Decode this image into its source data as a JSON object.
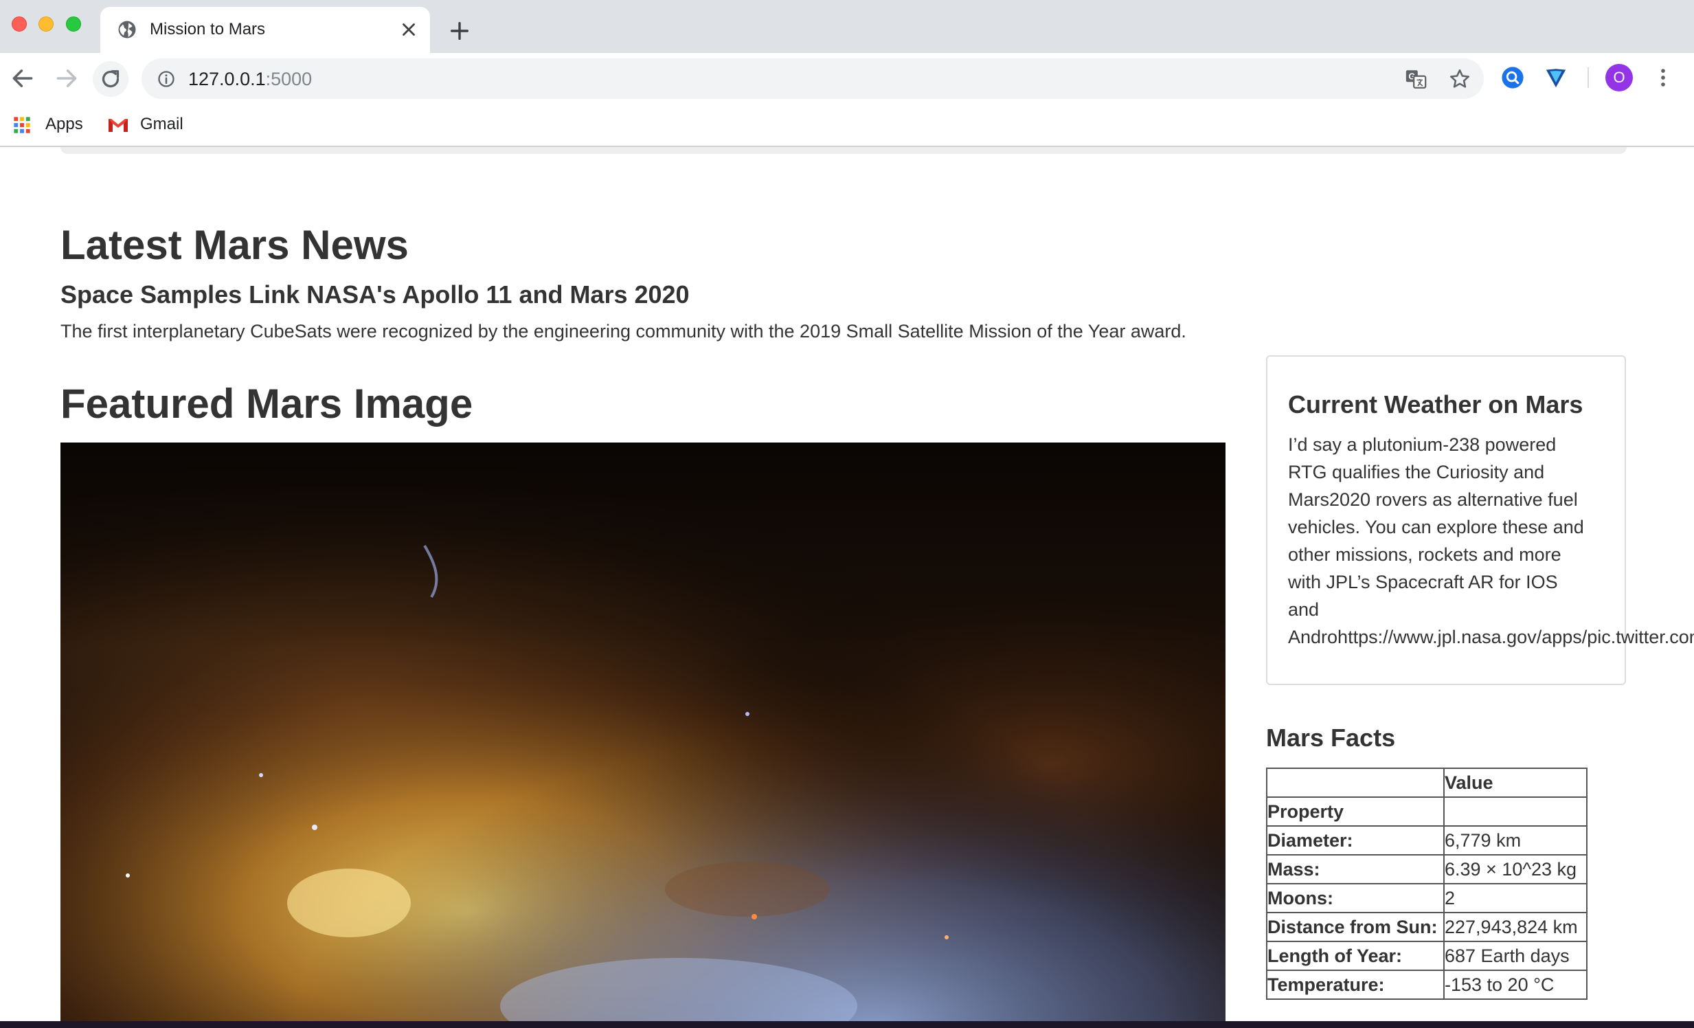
{
  "browser": {
    "tab_title": "Mission to Mars",
    "url_host": "127.0.0.1",
    "url_port": ":5000",
    "profile_initial": "O",
    "bookmarks": [
      {
        "label": "Apps",
        "icon": "apps-grid-icon"
      },
      {
        "label": "Gmail",
        "icon": "gmail-icon"
      }
    ]
  },
  "news": {
    "heading": "Latest Mars News",
    "title": "Space Samples Link NASA's Apollo 11 and Mars 2020",
    "teaser": "The first interplanetary CubeSats were recognized by the engineering community with the 2019 Small Satellite Mission of the Year award."
  },
  "featured": {
    "heading": "Featured Mars Image"
  },
  "weather": {
    "heading": "Current Weather on Mars",
    "lines": [
      "I’d say a plutonium-238 powered",
      "RTG qualifies the Curiosity and",
      "Mars2020 rovers as alternative fuel",
      "vehicles. You can explore these and",
      "other missions, rockets and more",
      "with JPL’s Spacecraft AR for IOS",
      "and",
      "Androhttps://www.jpl.nasa.gov/apps/pic.twitter.com"
    ]
  },
  "facts": {
    "heading": "Mars Facts",
    "column_header": "Value",
    "index_header": "Property",
    "rows": [
      {
        "property": "Diameter:",
        "value": "6,779 km"
      },
      {
        "property": "Mass:",
        "value": "6.39 × 10^23 kg"
      },
      {
        "property": "Moons:",
        "value": "2"
      },
      {
        "property": "Distance from Sun:",
        "value": "227,943,824 km"
      },
      {
        "property": "Length of Year:",
        "value": "687 Earth days"
      },
      {
        "property": "Temperature:",
        "value": "-153 to 20 °C"
      }
    ]
  },
  "colors": {
    "tabbar": "#dee1e6",
    "text": "#333333",
    "profile": "#9334e6"
  }
}
